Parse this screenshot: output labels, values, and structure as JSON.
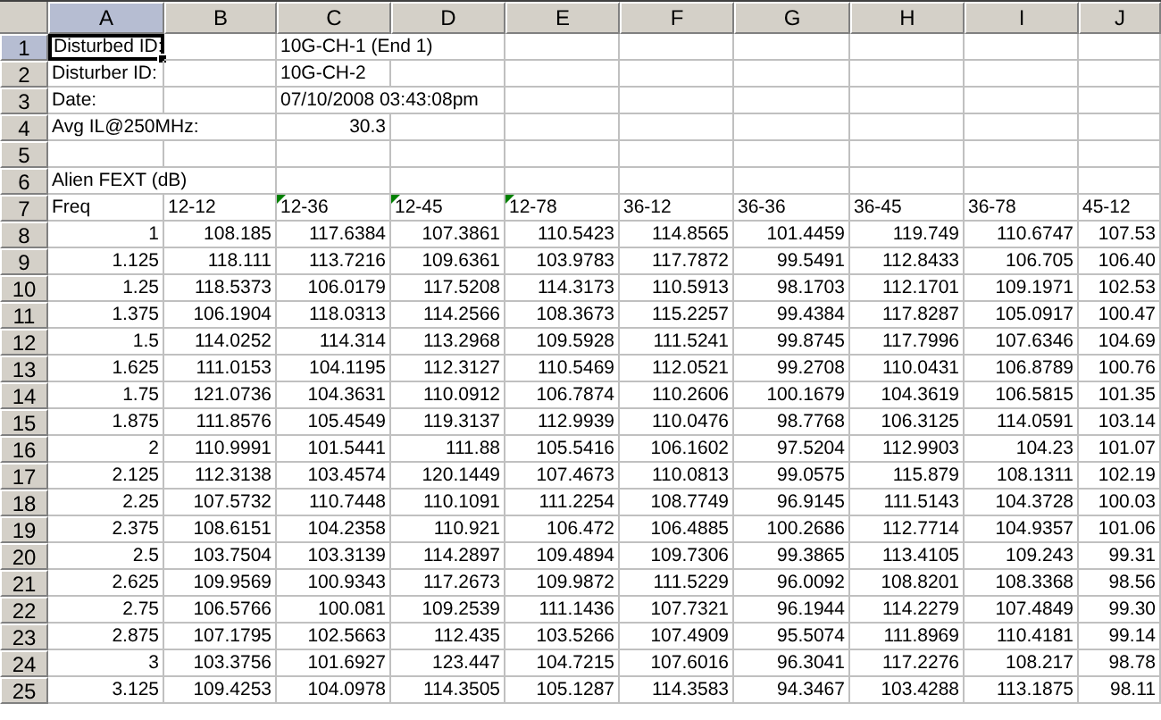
{
  "columns": [
    {
      "label": "A",
      "selected": true
    },
    {
      "label": "B",
      "selected": false
    },
    {
      "label": "C",
      "selected": false
    },
    {
      "label": "D",
      "selected": false
    },
    {
      "label": "E",
      "selected": false
    },
    {
      "label": "F",
      "selected": false
    },
    {
      "label": "G",
      "selected": false
    },
    {
      "label": "H",
      "selected": false
    },
    {
      "label": "I",
      "selected": false
    },
    {
      "label": "J",
      "selected": false
    }
  ],
  "rows": [
    {
      "number": "1",
      "selected": true,
      "cells": {
        "A": "Disturbed ID:",
        "C": "10G-CH-1 (End 1)"
      }
    },
    {
      "number": "2",
      "selected": false,
      "cells": {
        "A": "Disturber ID:",
        "C": "10G-CH-2"
      }
    },
    {
      "number": "3",
      "selected": false,
      "cells": {
        "A": "Date:",
        "C": "07/10/2008 03:43:08pm"
      }
    },
    {
      "number": "4",
      "selected": false,
      "cells": {
        "A": "Avg IL@250MHz:",
        "C": "30.3"
      }
    },
    {
      "number": "5",
      "selected": false,
      "cells": {}
    },
    {
      "number": "6",
      "selected": false,
      "cells": {
        "A": "Alien FEXT (dB)"
      }
    },
    {
      "number": "7",
      "selected": false,
      "cells": {
        "A": "Freq",
        "B": "12-12",
        "C": "12-36",
        "D": "12-45",
        "E": "12-78",
        "F": "36-12",
        "G": "36-36",
        "H": "36-45",
        "I": "36-78",
        "J": "45-12"
      },
      "error_marks": {
        "C": true,
        "D": true,
        "E": true
      }
    },
    {
      "number": "8",
      "selected": false,
      "cells": {
        "A": "1",
        "B": "108.185",
        "C": "117.6384",
        "D": "107.3861",
        "E": "110.5423",
        "F": "114.8565",
        "G": "101.4459",
        "H": "119.749",
        "I": "110.6747",
        "J": "107.53"
      }
    },
    {
      "number": "9",
      "selected": false,
      "cells": {
        "A": "1.125",
        "B": "118.111",
        "C": "113.7216",
        "D": "109.6361",
        "E": "103.9783",
        "F": "117.7872",
        "G": "99.5491",
        "H": "112.8433",
        "I": "106.705",
        "J": "106.40"
      }
    },
    {
      "number": "10",
      "selected": false,
      "cells": {
        "A": "1.25",
        "B": "118.5373",
        "C": "106.0179",
        "D": "117.5208",
        "E": "114.3173",
        "F": "110.5913",
        "G": "98.1703",
        "H": "112.1701",
        "I": "109.1971",
        "J": "102.53"
      }
    },
    {
      "number": "11",
      "selected": false,
      "cells": {
        "A": "1.375",
        "B": "106.1904",
        "C": "118.0313",
        "D": "114.2566",
        "E": "108.3673",
        "F": "115.2257",
        "G": "99.4384",
        "H": "117.8287",
        "I": "105.0917",
        "J": "100.47"
      }
    },
    {
      "number": "12",
      "selected": false,
      "cells": {
        "A": "1.5",
        "B": "114.0252",
        "C": "114.314",
        "D": "113.2968",
        "E": "109.5928",
        "F": "111.5241",
        "G": "99.8745",
        "H": "117.7996",
        "I": "107.6346",
        "J": "104.69"
      }
    },
    {
      "number": "13",
      "selected": false,
      "cells": {
        "A": "1.625",
        "B": "111.0153",
        "C": "104.1195",
        "D": "112.3127",
        "E": "110.5469",
        "F": "112.0521",
        "G": "99.2708",
        "H": "110.0431",
        "I": "106.8789",
        "J": "100.76"
      }
    },
    {
      "number": "14",
      "selected": false,
      "cells": {
        "A": "1.75",
        "B": "121.0736",
        "C": "104.3631",
        "D": "110.0912",
        "E": "106.7874",
        "F": "110.2606",
        "G": "100.1679",
        "H": "104.3619",
        "I": "106.5815",
        "J": "101.35"
      }
    },
    {
      "number": "15",
      "selected": false,
      "cells": {
        "A": "1.875",
        "B": "111.8576",
        "C": "105.4549",
        "D": "119.3137",
        "E": "112.9939",
        "F": "110.0476",
        "G": "98.7768",
        "H": "106.3125",
        "I": "114.0591",
        "J": "103.14"
      }
    },
    {
      "number": "16",
      "selected": false,
      "cells": {
        "A": "2",
        "B": "110.9991",
        "C": "101.5441",
        "D": "111.88",
        "E": "105.5416",
        "F": "106.1602",
        "G": "97.5204",
        "H": "112.9903",
        "I": "104.23",
        "J": "101.07"
      }
    },
    {
      "number": "17",
      "selected": false,
      "cells": {
        "A": "2.125",
        "B": "112.3138",
        "C": "103.4574",
        "D": "120.1449",
        "E": "107.4673",
        "F": "110.0813",
        "G": "99.0575",
        "H": "115.879",
        "I": "108.1311",
        "J": "102.19"
      }
    },
    {
      "number": "18",
      "selected": false,
      "cells": {
        "A": "2.25",
        "B": "107.5732",
        "C": "110.7448",
        "D": "110.1091",
        "E": "111.2254",
        "F": "108.7749",
        "G": "96.9145",
        "H": "111.5143",
        "I": "104.3728",
        "J": "100.03"
      }
    },
    {
      "number": "19",
      "selected": false,
      "cells": {
        "A": "2.375",
        "B": "108.6151",
        "C": "104.2358",
        "D": "110.921",
        "E": "106.472",
        "F": "106.4885",
        "G": "100.2686",
        "H": "112.7714",
        "I": "104.9357",
        "J": "101.06"
      }
    },
    {
      "number": "20",
      "selected": false,
      "cells": {
        "A": "2.5",
        "B": "103.7504",
        "C": "103.3139",
        "D": "114.2897",
        "E": "109.4894",
        "F": "109.7306",
        "G": "99.3865",
        "H": "113.4105",
        "I": "109.243",
        "J": "99.31"
      }
    },
    {
      "number": "21",
      "selected": false,
      "cells": {
        "A": "2.625",
        "B": "109.9569",
        "C": "100.9343",
        "D": "117.2673",
        "E": "109.9872",
        "F": "111.5229",
        "G": "96.0092",
        "H": "108.8201",
        "I": "108.3368",
        "J": "98.56"
      }
    },
    {
      "number": "22",
      "selected": false,
      "cells": {
        "A": "2.75",
        "B": "106.5766",
        "C": "100.081",
        "D": "109.2539",
        "E": "111.1436",
        "F": "107.7321",
        "G": "96.1944",
        "H": "114.2279",
        "I": "107.4849",
        "J": "99.30"
      }
    },
    {
      "number": "23",
      "selected": false,
      "cells": {
        "A": "2.875",
        "B": "107.1795",
        "C": "102.5663",
        "D": "112.435",
        "E": "103.5266",
        "F": "107.4909",
        "G": "95.5074",
        "H": "111.8969",
        "I": "110.4181",
        "J": "99.14"
      }
    },
    {
      "number": "24",
      "selected": false,
      "cells": {
        "A": "3",
        "B": "103.3756",
        "C": "101.6927",
        "D": "123.447",
        "E": "104.7215",
        "F": "107.6016",
        "G": "96.3041",
        "H": "117.2276",
        "I": "108.217",
        "J": "98.78"
      }
    },
    {
      "number": "25",
      "selected": false,
      "cells": {
        "A": "3.125",
        "B": "109.4253",
        "C": "104.0978",
        "D": "114.3505",
        "E": "105.1287",
        "F": "114.3583",
        "G": "94.3467",
        "H": "103.4288",
        "I": "113.1875",
        "J": "98.11"
      }
    }
  ]
}
